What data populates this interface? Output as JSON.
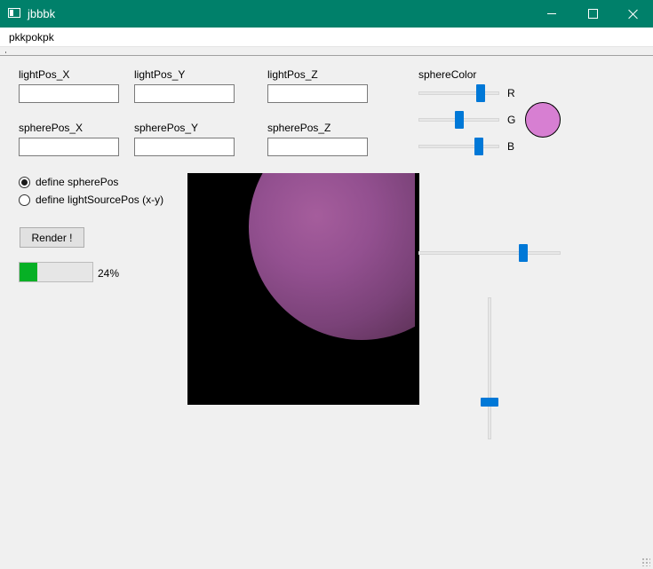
{
  "window": {
    "title": "jbbbk",
    "titlebar_color": "#00806a"
  },
  "menu": {
    "items": [
      "pkkpokpk"
    ]
  },
  "light_pos": {
    "x_label": "lightPos_X",
    "y_label": "lightPos_Y",
    "z_label": "lightPos_Z",
    "x_value": "",
    "y_value": "",
    "z_value": ""
  },
  "sphere_pos": {
    "x_label": "spherePos_X",
    "y_label": "spherePos_Y",
    "z_label": "spherePos_Z",
    "x_value": "",
    "y_value": "",
    "z_value": ""
  },
  "sphere_color": {
    "label": "sphereColor",
    "r_label": "R",
    "g_label": "G",
    "b_label": "B",
    "r_level": 0.8,
    "g_level": 0.5,
    "b_level": 0.78,
    "preview_color": "#d77fd2"
  },
  "mode": {
    "options": [
      "define spherePos",
      "define lightSourcePos (x-y)"
    ],
    "selected_index": 0
  },
  "render_button": {
    "label": "Render !"
  },
  "progress": {
    "percent": 24,
    "text": "24%",
    "fill_color": "#06b025"
  },
  "sliders": {
    "horizontal_level": 0.75,
    "vertical_level": 0.75,
    "accent_color": "#0078d7"
  }
}
